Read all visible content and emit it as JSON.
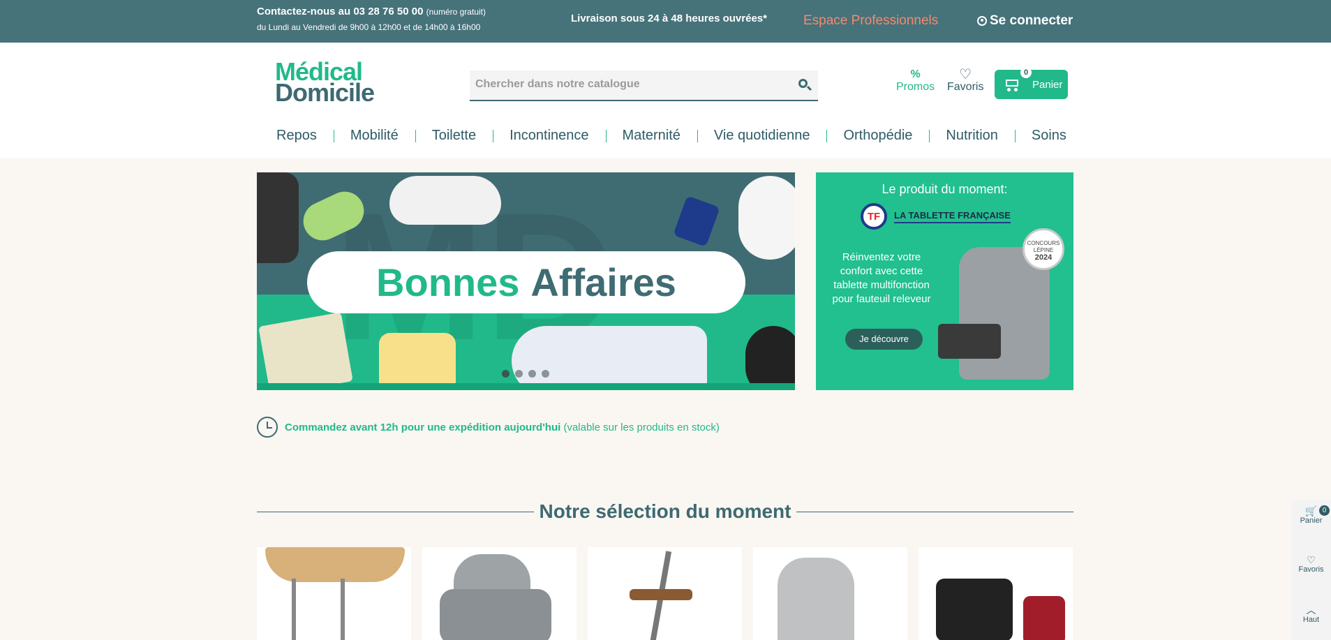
{
  "topbar": {
    "contact_prefix": "Contactez-nous au ",
    "contact_phone": "03 28 76 50 00",
    "contact_note": "(numéro gratuit)",
    "hours": "du Lundi au Vendredi de 9h00 à 12h00 et de 14h00 à 16h00",
    "delivery": "Livraison sous 24 à 48 heures ouvrées*",
    "pro_link": "Espace Professionnels",
    "login": "Se connecter"
  },
  "header": {
    "logo_line1": "Médical",
    "logo_line2": "Domicile",
    "search_placeholder": "Chercher dans notre catalogue",
    "promos_label": "Promos",
    "promos_symbol": "%",
    "favoris_label": "Favoris",
    "cart_label": "Panier",
    "cart_count": "0"
  },
  "nav": {
    "items": [
      {
        "label": "Repos"
      },
      {
        "label": "Mobilité"
      },
      {
        "label": "Toilette"
      },
      {
        "label": "Incontinence"
      },
      {
        "label": "Maternité"
      },
      {
        "label": "Vie quotidienne"
      },
      {
        "label": "Orthopédie"
      },
      {
        "label": "Nutrition"
      },
      {
        "label": "Soins"
      }
    ]
  },
  "banner": {
    "word1": "Bonnes",
    "word2": "Affaires",
    "slides_count": 4,
    "active_slide": 1
  },
  "side_banner": {
    "title": "Le produit du moment:",
    "brand": "LA TABLETTE FRANÇAISE",
    "brand_logo_letter": "TF",
    "description": "Réinventez votre confort avec cette tablette multifonction pour fauteuil releveur",
    "button": "Je découvre",
    "medal_line1": "CONCOURS LÉPINE",
    "medal_year": "2024"
  },
  "notice": {
    "bold": "Commandez avant 12h pour une expédition aujourd'hui",
    "light": "(valable sur les produits en stock)"
  },
  "selection": {
    "title": "Notre sélection du moment"
  },
  "floating": {
    "cart_label": "Panier",
    "cart_count": "0",
    "fav_label": "Favoris",
    "up_label": "Haut"
  },
  "colors": {
    "teal_dark": "#46727a",
    "green": "#21b98a",
    "orange": "#f58a6c",
    "cream": "#faf6f1"
  }
}
